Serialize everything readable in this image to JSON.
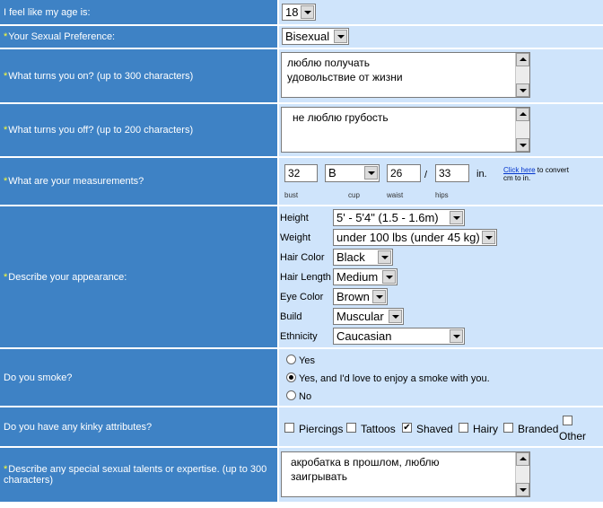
{
  "age": {
    "label": "I feel like my age is:",
    "value": "18"
  },
  "preference": {
    "label": "Your Sexual Preference:",
    "value": "Bisexual"
  },
  "turn_on": {
    "label": "What turns you on? (up to 300 characters)",
    "lines": [
      "люблю получать",
      "удовольствие от жизни"
    ]
  },
  "turn_off": {
    "label": "What turns you off? (up to 200 characters)",
    "lines": [
      "не люблю грубость"
    ]
  },
  "measurements": {
    "label": "What are your measurements?",
    "bust": "32",
    "cup": "B",
    "waist": "26",
    "hips": "33",
    "slash": "/",
    "unit": "in.",
    "sub_bust": "bust",
    "sub_cup": "cup",
    "sub_waist": "waist",
    "sub_hips": "hips",
    "link_text": "Click here",
    "link_rest": " to convert",
    "link_line2": "cm to in."
  },
  "appearance": {
    "label": "Describe your appearance:",
    "fields": [
      {
        "label": "Height",
        "value": "5' - 5'4\" (1.5 - 1.6m)"
      },
      {
        "label": "Weight",
        "value": "under 100 lbs (under 45 kg)"
      },
      {
        "label": "Hair Color",
        "value": "Black"
      },
      {
        "label": "Hair Length",
        "value": "Medium"
      },
      {
        "label": "Eye Color",
        "value": "Brown"
      },
      {
        "label": "Build",
        "value": "Muscular"
      },
      {
        "label": "Ethnicity",
        "value": "Caucasian"
      }
    ]
  },
  "smoke": {
    "label": "Do you smoke?",
    "options": [
      "Yes",
      "Yes, and I'd love to enjoy a smoke with you.",
      "No"
    ],
    "selected": 1
  },
  "kinky": {
    "label": "Do you have any kinky attributes?",
    "options": [
      "Piercings",
      "Tattoos",
      "Shaved",
      "Hairy",
      "Branded",
      "Other"
    ],
    "checked": [
      "Shaved"
    ]
  },
  "talents": {
    "label": "Describe any special sexual talents or expertise. (up to 300 characters)",
    "lines": [
      "акробатка в прошлом, люблю",
      "заигрывать"
    ]
  },
  "colors": {
    "label_bg": "#3e82c5",
    "value_bg": "#cfe4fb",
    "required_star": "#ffff33"
  }
}
